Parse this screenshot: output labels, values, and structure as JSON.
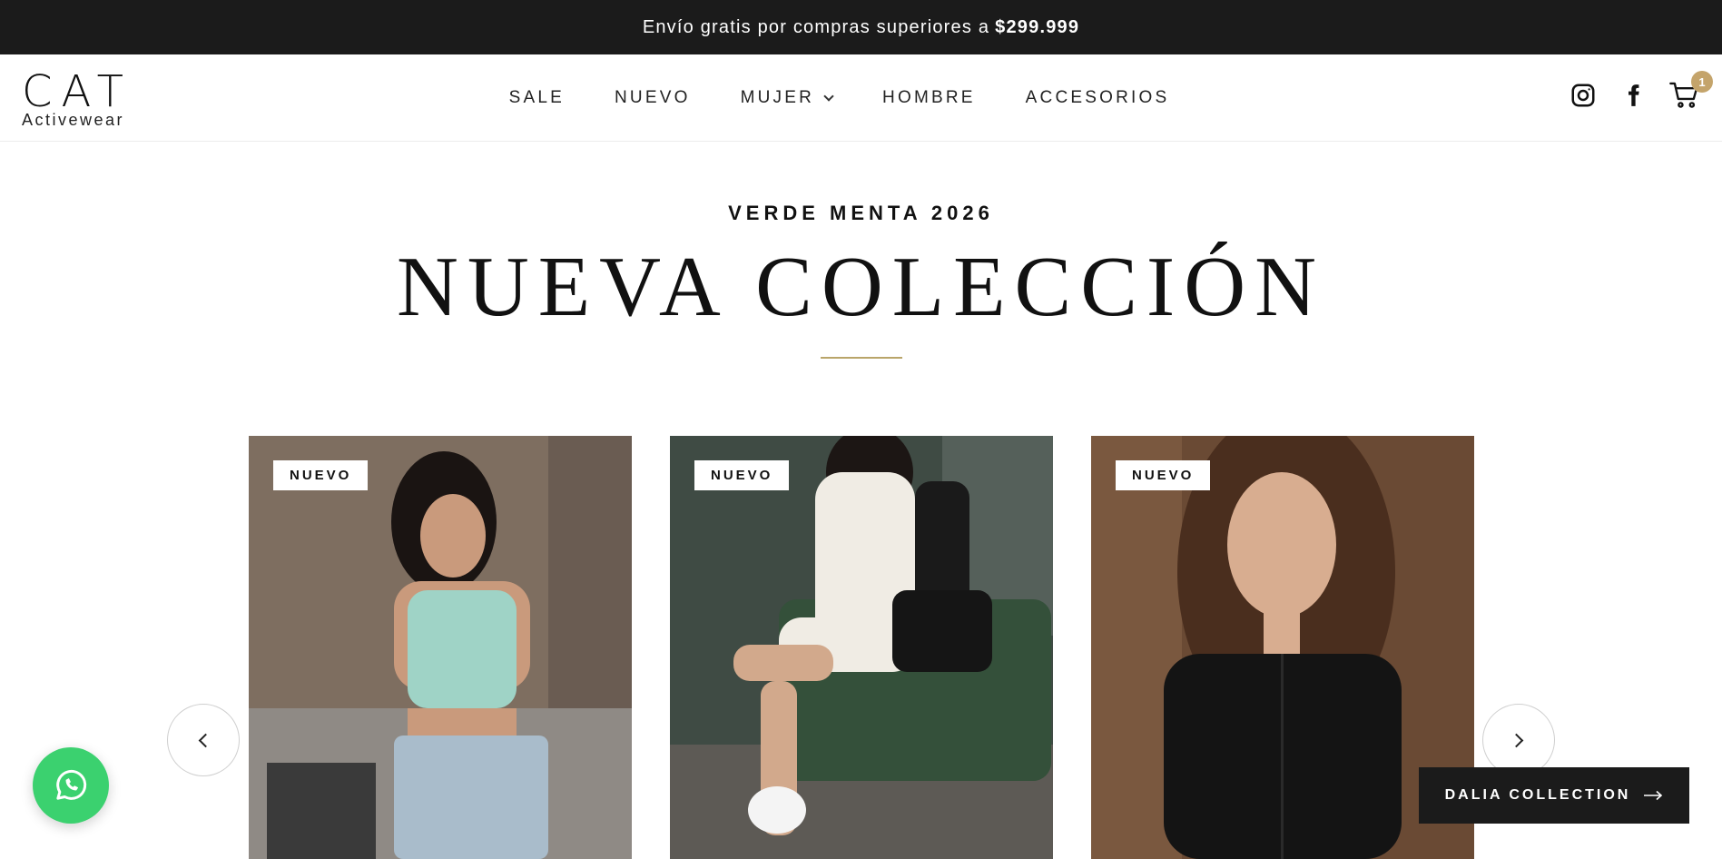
{
  "announcement": {
    "text": "Envío gratis por compras superiores a",
    "amount": "$299.999"
  },
  "logo": {
    "mark": "CAT",
    "subtitle": "Activewear"
  },
  "nav": {
    "items": [
      {
        "label": "SALE"
      },
      {
        "label": "NUEVO"
      },
      {
        "label": "MUJER",
        "has_dropdown": true
      },
      {
        "label": "HOMBRE"
      },
      {
        "label": "ACCESORIOS"
      }
    ]
  },
  "header_icons": [
    "instagram-icon",
    "facebook-icon",
    "cart-icon"
  ],
  "cart": {
    "count": "1",
    "badge_color": "#c4a46b"
  },
  "hero": {
    "eyebrow": "VERDE MENTA 2026",
    "title": "NUEVA COLECCIÓN",
    "divider_color": "#b9a56a"
  },
  "products": [
    {
      "badge": "NUEVO"
    },
    {
      "badge": "NUEVO"
    },
    {
      "badge": "NUEVO"
    }
  ],
  "cta": {
    "label": "DALIA COLLECTION",
    "icon": "arrow-right-icon"
  },
  "whatsapp": {
    "icon": "whatsapp-icon",
    "color": "#3bd16f"
  }
}
